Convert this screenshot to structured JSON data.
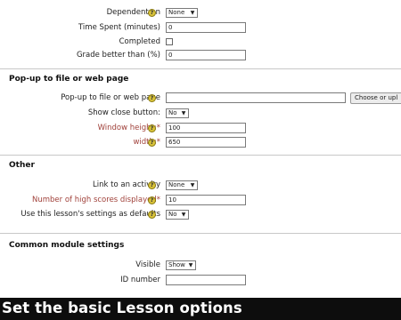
{
  "top_fields": {
    "dependent_on": {
      "label": "Dependent on",
      "value": "None"
    },
    "time_spent": {
      "label": "Time Spent (minutes)",
      "value": "0"
    },
    "completed": {
      "label": "Completed"
    },
    "grade_better_than": {
      "label": "Grade better than (%)",
      "value": "0"
    }
  },
  "popup_section": {
    "title": "Pop-up to file or web page",
    "popup_file": {
      "label": "Pop-up to file or web page",
      "value": "",
      "button": "Choose or upl"
    },
    "show_close": {
      "label": "Show close button:",
      "value": "No"
    },
    "window_height": {
      "label": "Window height:*",
      "value": "100"
    },
    "width": {
      "label": "width:*",
      "value": "650"
    }
  },
  "other_section": {
    "title": "Other",
    "link_activity": {
      "label": "Link to an activity",
      "value": "None"
    },
    "high_scores": {
      "label": "Number of high scores displayed*",
      "value": "10"
    },
    "use_defaults": {
      "label": "Use this lesson's settings as defaults",
      "value": "No"
    }
  },
  "common_section": {
    "title": "Common module settings",
    "visible": {
      "label": "Visible",
      "value": "Show"
    },
    "id_number": {
      "label": "ID number",
      "value": ""
    }
  },
  "help_icon_glyph": "?",
  "caption": "Set the basic Lesson options",
  "colors": {
    "required_label": "#a0413a",
    "help_icon": "#d8c23a",
    "caption_bg": "#0d0d0d"
  }
}
